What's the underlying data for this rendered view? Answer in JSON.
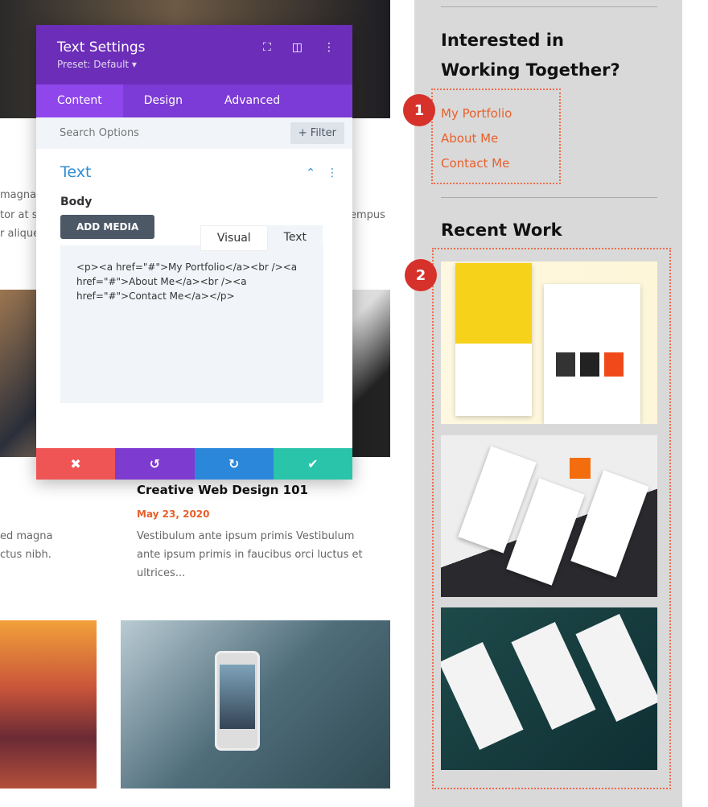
{
  "background_posts": {
    "left_partial_lines_top": [
      "magna",
      "tor at se",
      "r alique"
    ],
    "right_partial_top": "empus",
    "post": {
      "title": "Creative Web Design 101",
      "date": "May 23, 2020",
      "excerpt": [
        "Vestibulum ante ipsum primis Vestibulum",
        "ante ipsum primis in faucibus orci luctus et",
        "ultrices..."
      ]
    },
    "left_partial_lines_bottom": [
      "ed magna",
      "ctus nibh."
    ]
  },
  "sidebar": {
    "heading": [
      "Interested in",
      "Working Together?"
    ],
    "links": [
      "My Portfolio",
      "About Me",
      "Contact Me"
    ],
    "recent_heading": "Recent Work",
    "badges": [
      "1",
      "2"
    ]
  },
  "modal": {
    "title": "Text Settings",
    "preset": "Preset: Default ▾",
    "tabs": [
      "Content",
      "Design",
      "Advanced"
    ],
    "active_tab": "Content",
    "search_placeholder": "Search Options",
    "filter": "+ Filter",
    "section_title": "Text",
    "body_label": "Body",
    "add_media": "ADD MEDIA",
    "editor_tabs": [
      "Visual",
      "Text"
    ],
    "content": "<p><a href=\"#\">My Portfolio</a><br /><a href=\"#\">About Me</a><br /><a href=\"#\">Contact Me</a></p>",
    "footer_icons": [
      "close-icon",
      "undo-icon",
      "redo-icon",
      "check-icon"
    ],
    "colors": {
      "header": "#6c2eb9",
      "cancel": "#ef5555",
      "undo": "#7e3bd0",
      "redo": "#2b87da",
      "save": "#29c4a9"
    }
  }
}
